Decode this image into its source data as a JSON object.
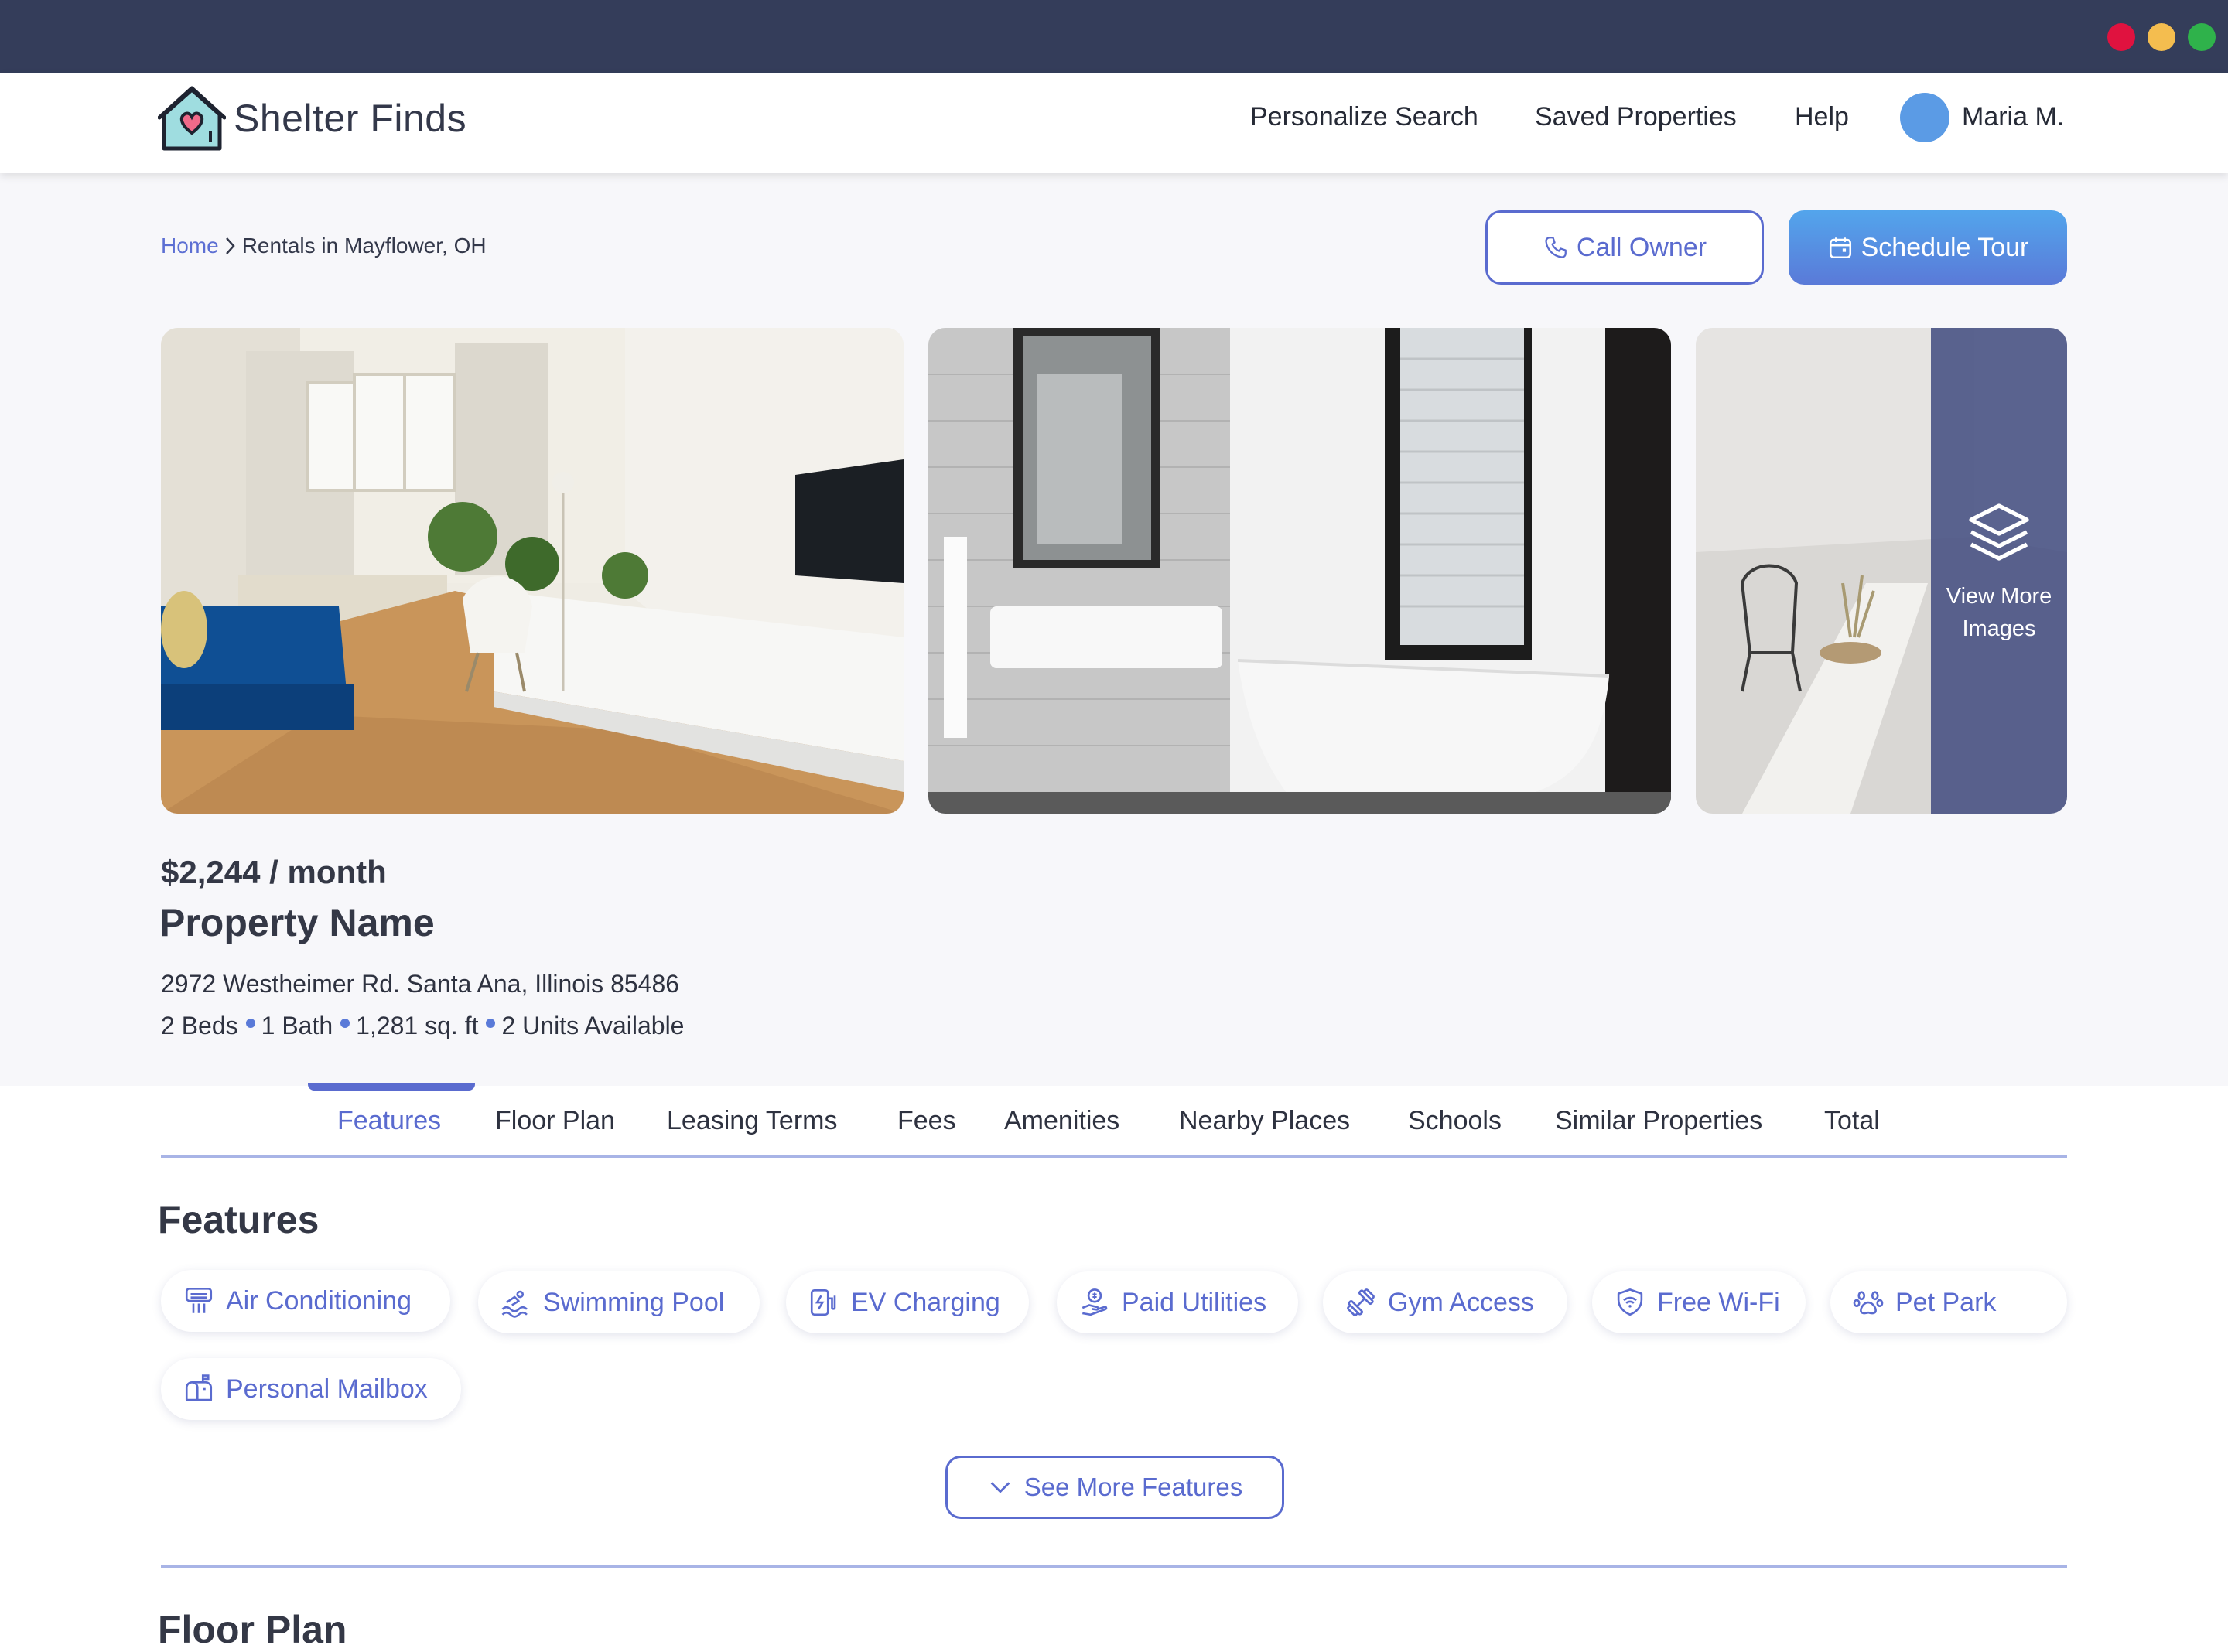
{
  "app": {
    "name": "Shelter Finds"
  },
  "nav": {
    "personalize_search": "Personalize Search",
    "saved_properties": "Saved Properties",
    "help": "Help",
    "user_name": "Maria M."
  },
  "breadcrumb": {
    "home": "Home",
    "current": "Rentals in Mayflower, OH"
  },
  "actions": {
    "call_owner": "Call Owner",
    "schedule_tour": "Schedule Tour"
  },
  "gallery": {
    "view_more": "View More Images"
  },
  "listing": {
    "price": "$2,244 / month",
    "name": "Property Name",
    "address": "2972 Westheimer Rd. Santa Ana, Illinois 85486",
    "beds": "2 Beds",
    "bath": "1 Bath",
    "area": "1,281 sq. ft",
    "units": "2 Units Available"
  },
  "tabs": [
    {
      "label": "Features",
      "active": true
    },
    {
      "label": "Floor Plan",
      "active": false
    },
    {
      "label": "Leasing Terms",
      "active": false
    },
    {
      "label": "Fees",
      "active": false
    },
    {
      "label": "Amenities",
      "active": false
    },
    {
      "label": "Nearby Places",
      "active": false
    },
    {
      "label": "Schools",
      "active": false
    },
    {
      "label": "Similar Properties",
      "active": false
    },
    {
      "label": "Total",
      "active": false
    }
  ],
  "features": {
    "title": "Features",
    "items": [
      {
        "label": "Air Conditioning",
        "icon": "air-conditioning-icon"
      },
      {
        "label": "Swimming Pool",
        "icon": "swimming-pool-icon"
      },
      {
        "label": "EV Charging",
        "icon": "ev-charging-icon"
      },
      {
        "label": "Paid Utilities",
        "icon": "paid-utilities-icon"
      },
      {
        "label": "Gym Access",
        "icon": "gym-icon"
      },
      {
        "label": "Free Wi-Fi",
        "icon": "wifi-icon"
      },
      {
        "label": "Pet Park",
        "icon": "paw-icon"
      },
      {
        "label": "Personal Mailbox",
        "icon": "mailbox-icon"
      }
    ],
    "see_more": "See More Features"
  },
  "floor_plan": {
    "title": "Floor Plan"
  },
  "colors": {
    "accent": "#5a6bcf",
    "chrome": "#343d5a",
    "primary_button": "#53a5ec"
  }
}
